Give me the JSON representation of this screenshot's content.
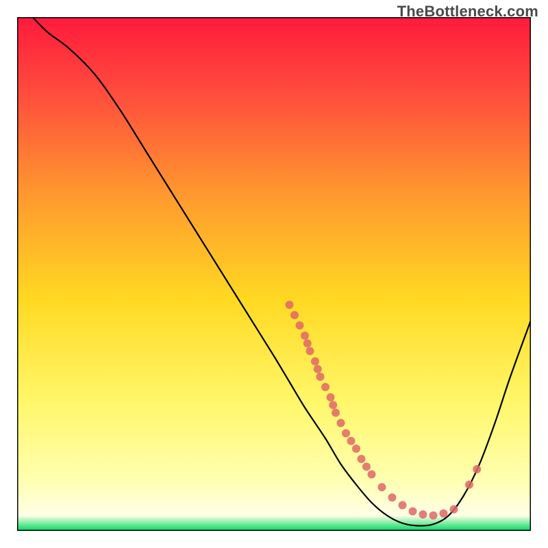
{
  "watermark": "TheBottleneck.com",
  "chart_data": {
    "type": "line",
    "title": "",
    "xlabel": "",
    "ylabel": "",
    "xlim": [
      0,
      100
    ],
    "ylim": [
      0,
      100
    ],
    "background_gradient": {
      "type": "vertical",
      "stops": [
        {
          "offset": 0.0,
          "color": "#ff1a3c"
        },
        {
          "offset": 0.15,
          "color": "#ff4d3d"
        },
        {
          "offset": 0.35,
          "color": "#ff9a2e"
        },
        {
          "offset": 0.55,
          "color": "#ffd922"
        },
        {
          "offset": 0.75,
          "color": "#fff76a"
        },
        {
          "offset": 0.9,
          "color": "#ffffb0"
        },
        {
          "offset": 0.97,
          "color": "#ffffe6"
        },
        {
          "offset": 1.0,
          "color": "#00d95f"
        }
      ]
    },
    "series": [
      {
        "name": "bottleneck-curve",
        "color": "#000000",
        "x": [
          3,
          6,
          10,
          15,
          20,
          25,
          30,
          35,
          40,
          45,
          50,
          53,
          56,
          60,
          63,
          66,
          69,
          72,
          75,
          78,
          81,
          84,
          87,
          90,
          93,
          96,
          100
        ],
        "y": [
          100,
          97,
          94,
          89,
          82,
          74,
          66,
          58,
          50,
          42,
          34,
          29,
          24,
          18,
          13,
          9,
          5.5,
          3,
          1.5,
          1,
          1.3,
          3,
          7,
          13,
          21,
          30,
          41
        ]
      }
    ],
    "markers": {
      "name": "data-points",
      "color": "#e06666",
      "radius": 6,
      "points": [
        {
          "x": 53,
          "y": 44
        },
        {
          "x": 54,
          "y": 42
        },
        {
          "x": 55,
          "y": 40
        },
        {
          "x": 56,
          "y": 38
        },
        {
          "x": 56.5,
          "y": 36.5
        },
        {
          "x": 57,
          "y": 35
        },
        {
          "x": 58,
          "y": 33
        },
        {
          "x": 58.5,
          "y": 31.5
        },
        {
          "x": 59,
          "y": 30
        },
        {
          "x": 60,
          "y": 28
        },
        {
          "x": 61,
          "y": 26
        },
        {
          "x": 61.5,
          "y": 24.5
        },
        {
          "x": 62,
          "y": 23
        },
        {
          "x": 63,
          "y": 21
        },
        {
          "x": 64,
          "y": 19
        },
        {
          "x": 65,
          "y": 17.5
        },
        {
          "x": 66,
          "y": 16
        },
        {
          "x": 67,
          "y": 14
        },
        {
          "x": 68,
          "y": 12.5
        },
        {
          "x": 69,
          "y": 11
        },
        {
          "x": 71,
          "y": 8.5
        },
        {
          "x": 73,
          "y": 6.5
        },
        {
          "x": 75,
          "y": 5
        },
        {
          "x": 77,
          "y": 3.8
        },
        {
          "x": 79,
          "y": 3.2
        },
        {
          "x": 81,
          "y": 3
        },
        {
          "x": 83,
          "y": 3.4
        },
        {
          "x": 85,
          "y": 4.2
        },
        {
          "x": 88,
          "y": 9
        },
        {
          "x": 89.5,
          "y": 12
        }
      ]
    }
  }
}
